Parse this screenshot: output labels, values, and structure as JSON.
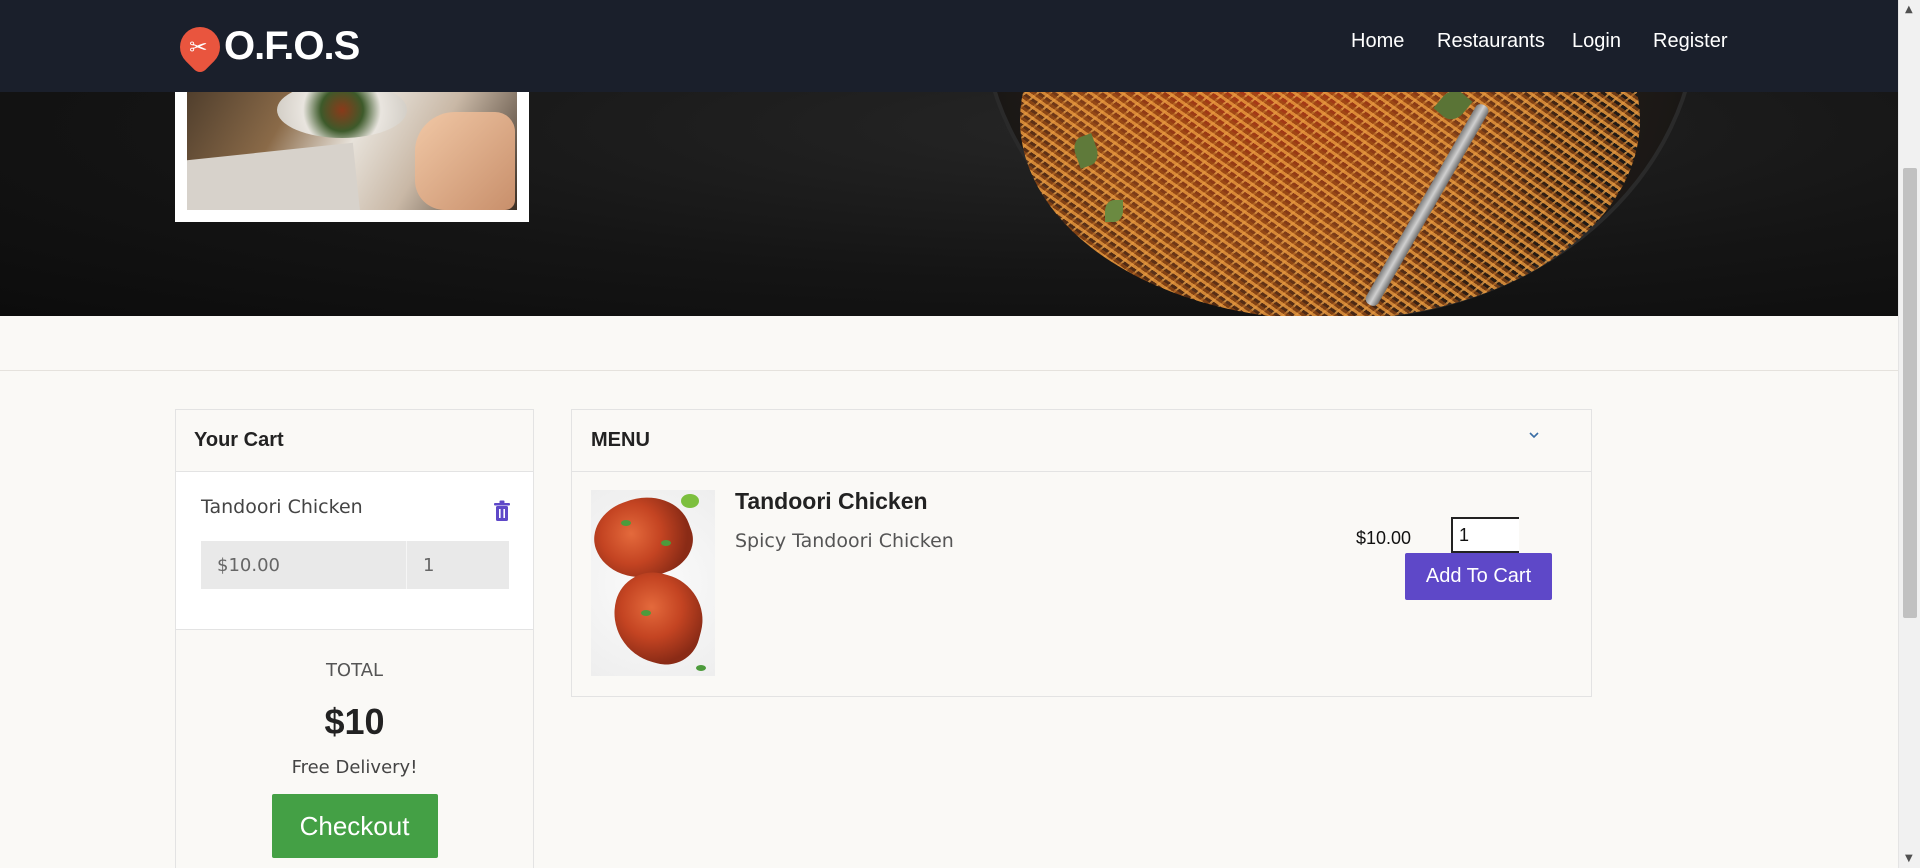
{
  "brand": {
    "logo_text": "O.F.O.S",
    "logo_glyph": "✂"
  },
  "nav": {
    "home": "Home",
    "restaurants": "Restaurants",
    "login": "Login",
    "register": "Register"
  },
  "cart": {
    "title": "Your Cart",
    "items": [
      {
        "name": "Tandoori Chicken",
        "price": "$10.00",
        "qty": "1"
      }
    ],
    "total_label": "TOTAL",
    "total_value": "$10",
    "delivery_note": "Free Delivery!",
    "checkout_label": "Checkout"
  },
  "menu": {
    "title": "MENU",
    "items": [
      {
        "name": "Tandoori Chicken",
        "description": "Spicy Tandoori Chicken",
        "price": "$10.00",
        "qty": "1",
        "add_label": "Add To Cart"
      }
    ]
  },
  "colors": {
    "navbar": "#1a1f2b",
    "accent": "#5e48c8",
    "checkout": "#44a045",
    "logo": "#e9553e"
  }
}
